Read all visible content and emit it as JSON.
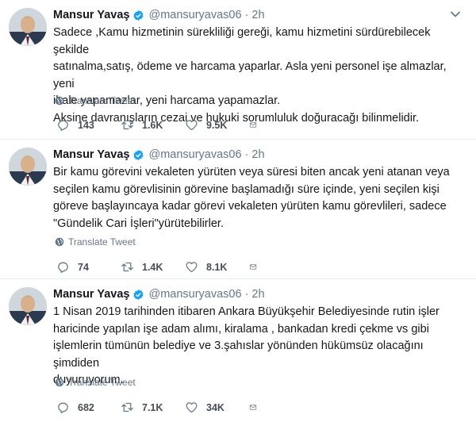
{
  "tweets": [
    {
      "author": "Mansur Yavaş",
      "handle": "@mansuryavas06",
      "separator": "·",
      "time": "2h",
      "lines": [
        "Sadece ,Kamu hizmetinin sürekliliği gereği, kamu hizmetini sürdürebilecek şekilde",
        "satınalma,satış, ödeme ve harcama yaparlar. Asla yeni personel işe almazlar, yeni",
        "ihale yapamazlar, yeni harcama yapamazlar.",
        "Aksine davranışların cezai ve hukuki sorumluluk doğuracağı bilinmelidir."
      ],
      "translate_label": "Translate Tweet",
      "replies": "143",
      "retweets": "1.6K",
      "likes": "9.5K"
    },
    {
      "author": "Mansur Yavaş",
      "handle": "@mansuryavas06",
      "separator": "·",
      "time": "2h",
      "lines": [
        "Bir kamu görevini vekaleten yürüten veya süresi biten ancak yeni atanan veya",
        "seçilen kamu görevlisinin görevine başlamadığı süre içinde, yeni seçilen kişi",
        "göreve başlayıncaya kadar görevi vekaleten yürüten kamu görevlileri, sadece",
        "\"Gündelik Cari İşleri\"yürütebilirler."
      ],
      "translate_label": "Translate Tweet",
      "replies": "74",
      "retweets": "1.4K",
      "likes": "8.1K"
    },
    {
      "author": "Mansur Yavaş",
      "handle": "@mansuryavas06",
      "separator": "·",
      "time": "2h",
      "lines": [
        "1 Nisan 2019 tarihinden itibaren Ankara Büyükşehir Belediyesinde rutin işler",
        "haricinde yapılan işe adam alımı, kiralama , bankadan kredi çekme vs gibi",
        "işlemlerin tümünün belediye ve 3.şahıslar yönünden hükümsüz olacağını şimdiden",
        "duyuruyorum."
      ],
      "translate_label": "Translate Tweet",
      "replies": "682",
      "retweets": "7.1K",
      "likes": "34K"
    }
  ],
  "colors": {
    "text": "#14171a",
    "muted": "#657786",
    "verified": "#1da1f2",
    "divider": "#e6ecf0"
  },
  "icons": {
    "verified": "verified-badge-icon",
    "more": "chevron-down-icon",
    "translate": "globe-icon",
    "reply": "reply-icon",
    "retweet": "retweet-icon",
    "like": "heart-icon",
    "message": "envelope-icon"
  }
}
